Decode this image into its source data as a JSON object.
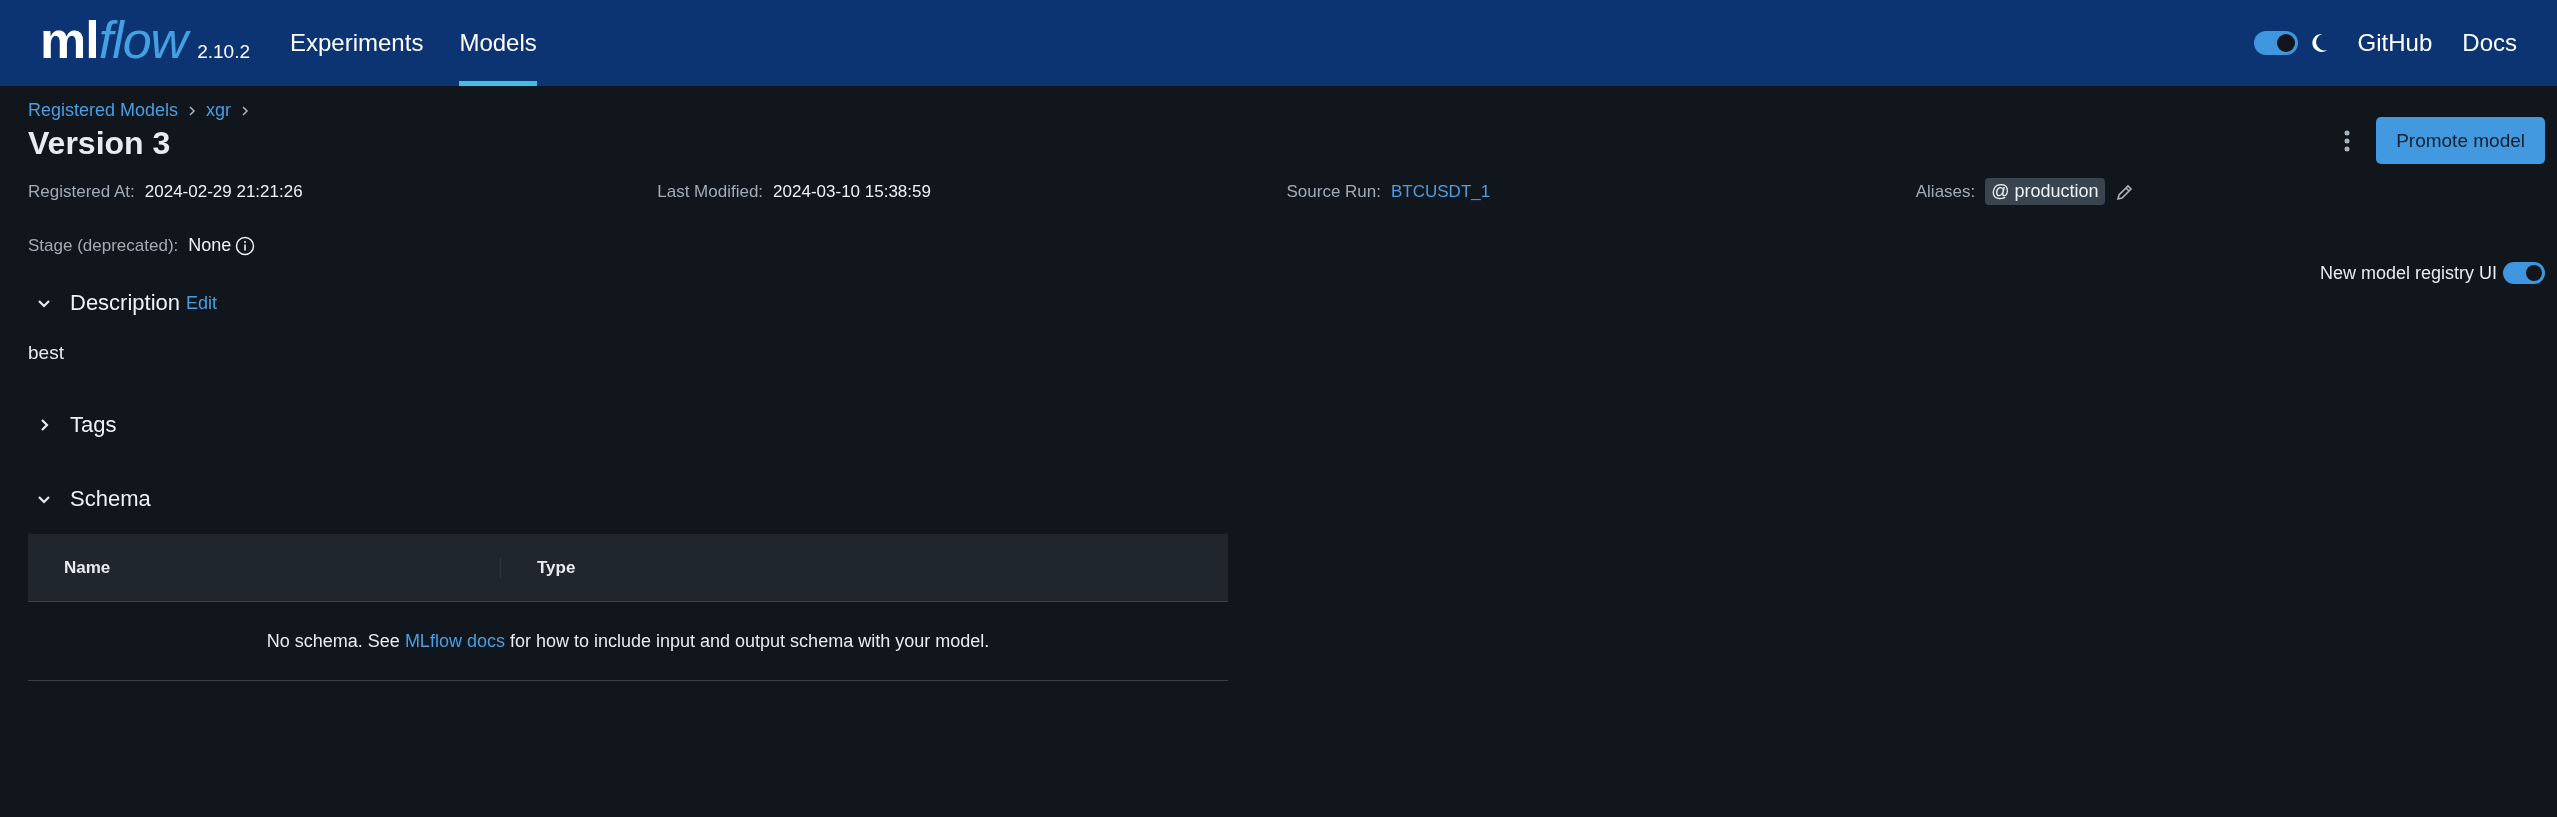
{
  "header": {
    "logo": {
      "mark": "ml",
      "word": "flow"
    },
    "version": "2.10.2",
    "nav": [
      {
        "label": "Experiments",
        "selected": false
      },
      {
        "label": "Models",
        "selected": true
      }
    ],
    "theme_toggle": {
      "on": true
    },
    "links": [
      "GitHub",
      "Docs"
    ]
  },
  "breadcrumb": [
    "Registered Models",
    "xgr"
  ],
  "title": "Version 3",
  "promote_button": "Promote model",
  "metadata": [
    {
      "label": "Registered At:",
      "value": "2024-02-29 21:21:26",
      "kind": "text"
    },
    {
      "label": "Last Modified:",
      "value": "2024-03-10 15:38:59",
      "kind": "text"
    },
    {
      "label": "Source Run:",
      "value": "BTCUSDT_1",
      "kind": "link"
    },
    {
      "label": "Aliases:",
      "value": "@ production",
      "kind": "alias"
    }
  ],
  "stage": {
    "label": "Stage (deprecated):",
    "value": "None"
  },
  "registry_toggle": {
    "label": "New model registry UI",
    "on": true
  },
  "sections": [
    {
      "title": "Description",
      "expanded": true,
      "edit": "Edit",
      "body": "best"
    },
    {
      "title": "Tags",
      "expanded": false
    },
    {
      "title": "Schema",
      "expanded": true,
      "table": {
        "columns": [
          "Name",
          "Type"
        ],
        "empty_message": {
          "before": "No schema. See ",
          "link": "MLflow docs",
          "after": " for how to include input and output schema with your model."
        }
      }
    }
  ]
}
